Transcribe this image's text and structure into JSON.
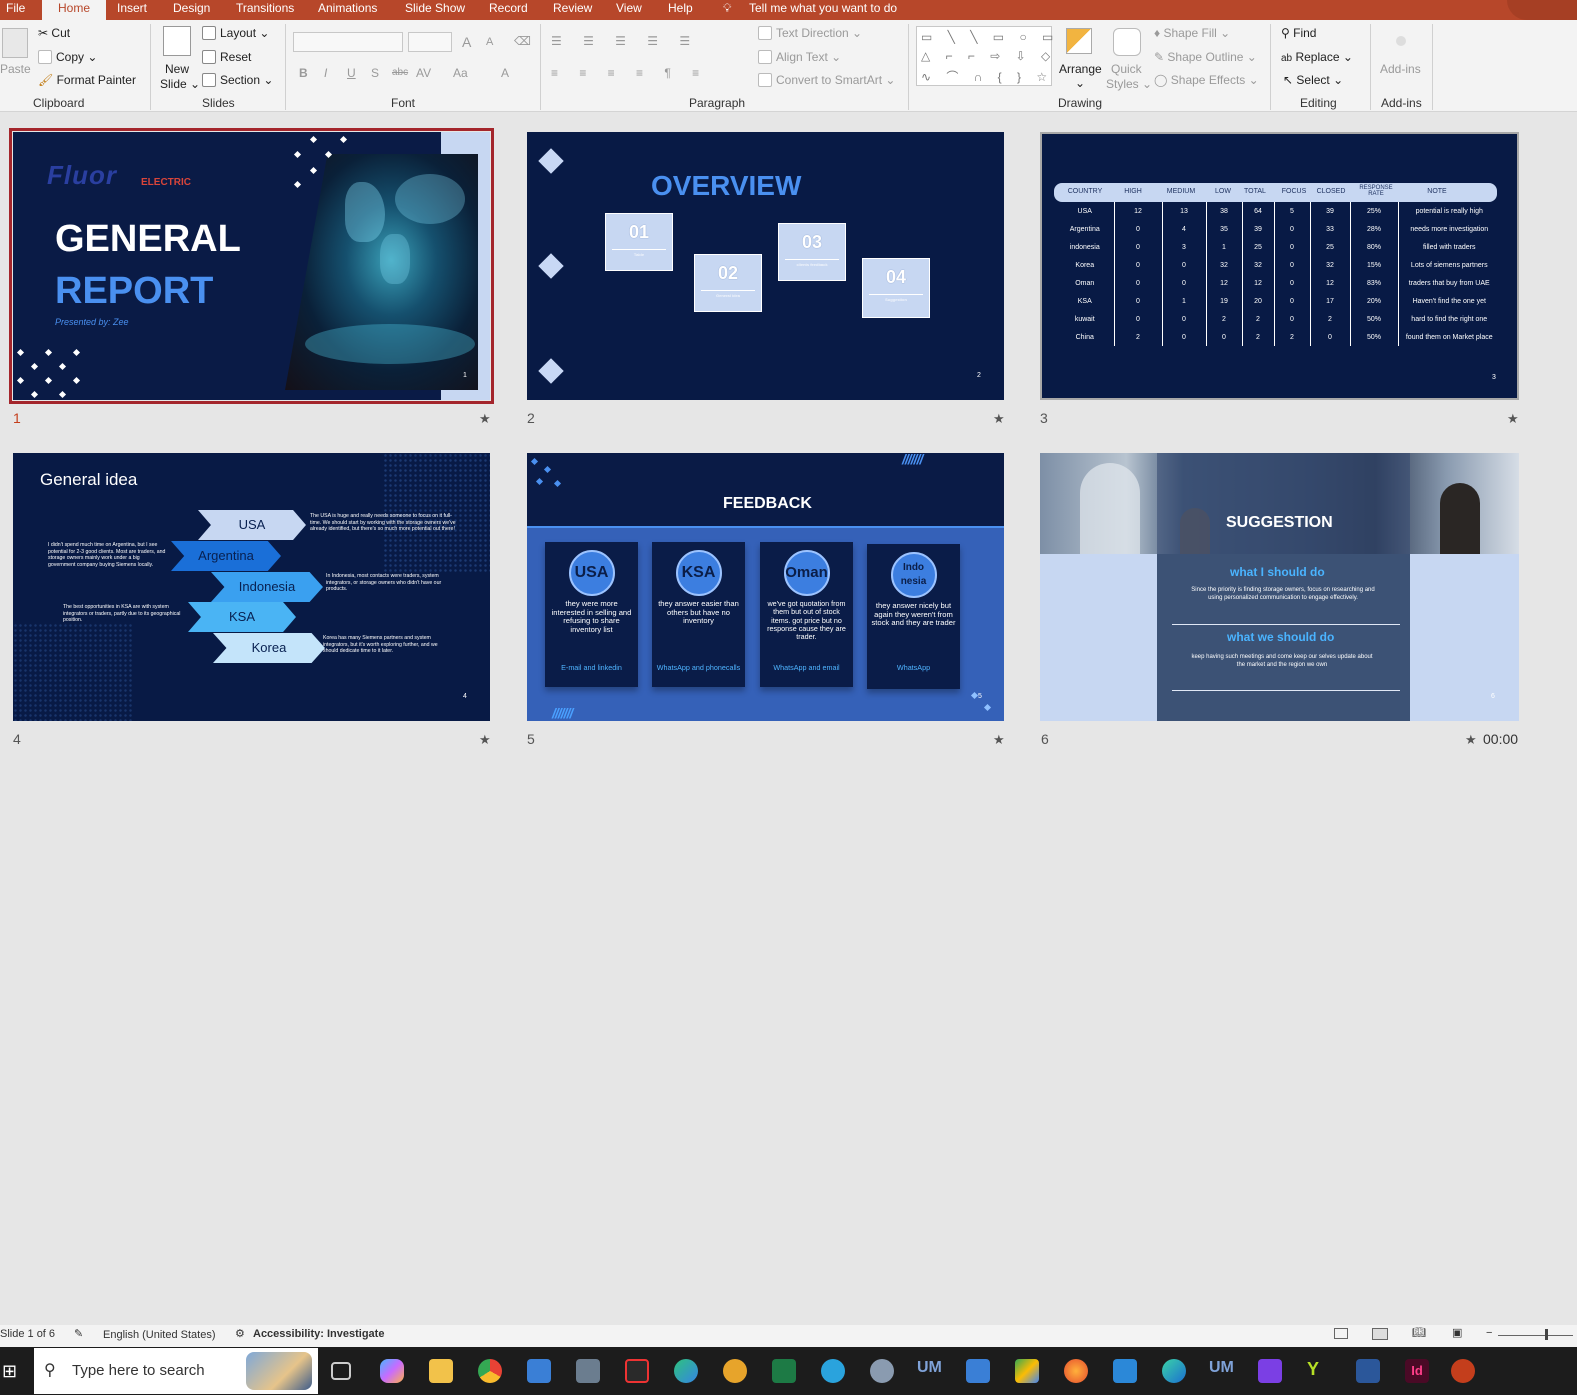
{
  "ribbon": {
    "tabs": [
      "File",
      "Home",
      "Insert",
      "Design",
      "Transitions",
      "Animations",
      "Slide Show",
      "Record",
      "Review",
      "View",
      "Help"
    ],
    "tell_me": "Tell me what you want to do",
    "clipboard": {
      "paste": "Paste",
      "cut": "Cut",
      "copy": "Copy",
      "format_painter": "Format Painter",
      "label": "Clipboard"
    },
    "slides": {
      "new_slide": "New",
      "new_slide2": "Slide",
      "layout": "Layout",
      "reset": "Reset",
      "section": "Section",
      "label": "Slides"
    },
    "font": {
      "label": "Font",
      "bold": "B",
      "italic": "I",
      "underline": "U",
      "shadow": "S",
      "strike": "abc",
      "spacing": "AV",
      "case": "Aa",
      "color": "A",
      "grow": "A",
      "shrink": "A"
    },
    "paragraph": {
      "label": "Paragraph",
      "text_direction": "Text Direction",
      "align_text": "Align Text",
      "smartart": "Convert to SmartArt"
    },
    "drawing": {
      "label": "Drawing",
      "arrange": "Arrange",
      "quick_styles": "Quick",
      "quick_styles2": "Styles",
      "shape_fill": "Shape Fill",
      "shape_outline": "Shape Outline",
      "shape_effects": "Shape Effects"
    },
    "editing": {
      "label": "Editing",
      "find": "Find",
      "replace": "Replace",
      "select": "Select"
    },
    "addins": {
      "label": "Add-ins",
      "button": "Add-ins"
    }
  },
  "slides": [
    {
      "num": "1",
      "logo": "Fluor",
      "logo_sub": "ELECTRIC",
      "title1": "GENERAL",
      "title2": "REPORT",
      "presenter": "Presented by: Zee",
      "page": "1"
    },
    {
      "num": "2",
      "title": "OVERVIEW",
      "cards": [
        {
          "n": "01",
          "s": "Table"
        },
        {
          "n": "02",
          "s": "General idea"
        },
        {
          "n": "03",
          "s": "clients feedback"
        },
        {
          "n": "04",
          "s": "Suggestion"
        }
      ],
      "page": "2"
    },
    {
      "num": "3",
      "headers": [
        "COUNTRY",
        "HIGH",
        "MEDIUM",
        "LOW",
        "TOTAL",
        "FOCUS",
        "CLOSED",
        "RESPONSE RATE",
        "NOTE"
      ],
      "rows": [
        [
          "USA",
          "12",
          "13",
          "38",
          "64",
          "5",
          "39",
          "25%",
          "potential is really high"
        ],
        [
          "Argentina",
          "0",
          "4",
          "35",
          "39",
          "0",
          "33",
          "28%",
          "needs more investigation"
        ],
        [
          "indonesia",
          "0",
          "3",
          "1",
          "25",
          "0",
          "25",
          "80%",
          "filled with traders"
        ],
        [
          "Korea",
          "0",
          "0",
          "32",
          "32",
          "0",
          "32",
          "15%",
          "Lots of siemens partners"
        ],
        [
          "Oman",
          "0",
          "0",
          "12",
          "12",
          "0",
          "12",
          "83%",
          "traders that buy from UAE"
        ],
        [
          "KSA",
          "0",
          "1",
          "19",
          "20",
          "0",
          "17",
          "20%",
          "Haven't find the one yet"
        ],
        [
          "kuwait",
          "0",
          "0",
          "2",
          "2",
          "0",
          "2",
          "50%",
          "hard to find the right one"
        ],
        [
          "China",
          "2",
          "0",
          "0",
          "2",
          "2",
          "0",
          "50%",
          "found them on Market place"
        ]
      ],
      "page": "3"
    },
    {
      "num": "4",
      "title": "General idea",
      "chevrons": [
        "USA",
        "Argentina",
        "Indonesia",
        "KSA",
        "Korea"
      ],
      "notes": {
        "usa": "The USA is huge and really needs someone to focus on it full-time. We should start by working with the storage owners we've already identified, but there's so much more potential out there!",
        "argentina": "I didn't spend much time on Argentina, but I see potential for 2-3 good clients. Most are traders, and storage owners mainly work under a big government company buying Siemens locally.",
        "indonesia": "In Indonesia, most contacts were traders, system integrators, or storage owners who didn't have our products.",
        "ksa": "The best opportunities in KSA are with system integrators or traders, partly due to its geographical position.",
        "korea": "Korea has many Siemens partners and system integrators, but it's worth exploring further, and we should dedicate time to it later."
      },
      "page": "4"
    },
    {
      "num": "5",
      "title": "FEEDBACK",
      "cards": [
        {
          "name": "USA",
          "text": "they were more interested in selling and refusing to share inventory list",
          "channel": "E-mail and linkedin"
        },
        {
          "name": "KSA",
          "text": "they answer easier than others but have no inventory",
          "channel": "WhatsApp and phonecalls"
        },
        {
          "name": "Oman",
          "text": "we've got quotation from them but out of stock items. got price but no response cause they are trader.",
          "channel": "WhatsApp and email"
        },
        {
          "name": "Indo nesia",
          "text": "they answer nicely but again they weren't from stock and they are trader",
          "channel": "WhatsApp"
        }
      ],
      "page": "5"
    },
    {
      "num": "6",
      "title": "SUGGESTION",
      "h1": "what I should do",
      "p1": "Since the priority is finding storage owners, focus on researching and using personalized communication to engage effectively.",
      "h2": "what we should do",
      "p2": "keep having such meetings and come keep our selves update about the market and the region we own",
      "page": "6",
      "timing": "00:00"
    }
  ],
  "status": {
    "slide": "Slide 1 of 6",
    "language": "English (United States)",
    "accessibility": "Accessibility: Investigate"
  },
  "taskbar": {
    "search": "Type here to search"
  },
  "colors": {
    "accent": "#b7472a",
    "slide_bg": "#081a45",
    "light_blue": "#c7d7f2",
    "bright_blue": "#4a90f0"
  }
}
